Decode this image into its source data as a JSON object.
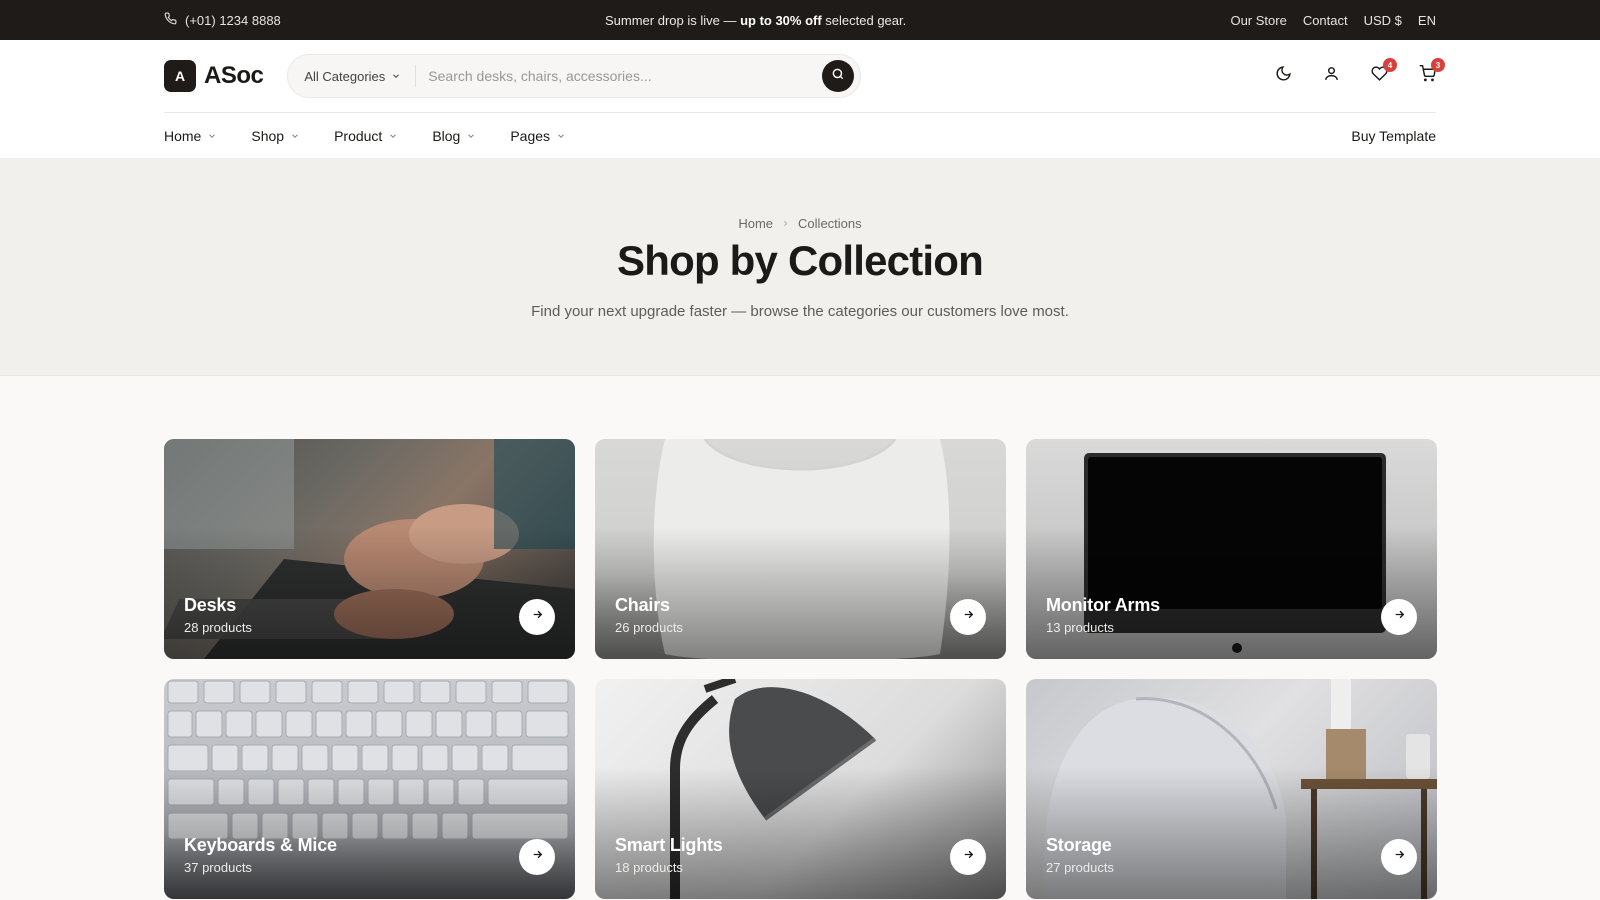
{
  "topbar": {
    "phone": "(+01) 1234 8888",
    "promo_prefix": "Summer drop is live — ",
    "promo_bold": "up to 30% off",
    "promo_suffix": " selected gear.",
    "links": [
      "Our Store",
      "Contact",
      "USD $",
      "EN"
    ]
  },
  "header": {
    "logo_mark": "A",
    "logo_text": "ASoc",
    "search": {
      "category": "All Categories",
      "placeholder": "Search desks, chairs, accessories...",
      "value": ""
    },
    "icons": {
      "theme": "moon-icon",
      "account": "user-icon",
      "wishlist": "heart-icon",
      "cart": "cart-icon"
    },
    "wishlist_count": "4",
    "cart_count": "3"
  },
  "nav": {
    "items": [
      "Home",
      "Shop",
      "Product",
      "Blog",
      "Pages"
    ],
    "cta": "Buy Template"
  },
  "hero": {
    "breadcrumb": [
      "Home",
      "Collections"
    ],
    "title": "Shop by Collection",
    "subtitle": "Find your next upgrade faster — browse the categories our customers love most."
  },
  "collections": [
    {
      "title": "Desks",
      "count": "28 products",
      "image": "hands-typing-laptop"
    },
    {
      "title": "Chairs",
      "count": "26 products",
      "image": "white-chair-back"
    },
    {
      "title": "Monitor Arms",
      "count": "13 products",
      "image": "monitor-screen"
    },
    {
      "title": "Keyboards & Mice",
      "count": "37 products",
      "image": "keyboard-keys"
    },
    {
      "title": "Smart Lights",
      "count": "18 products",
      "image": "desk-lamp"
    },
    {
      "title": "Storage",
      "count": "27 products",
      "image": "chair-and-shelf"
    }
  ],
  "colors": {
    "dark": "#1e1b19",
    "hero_bg": "#f2f0ec",
    "badge": "#d8403a"
  }
}
